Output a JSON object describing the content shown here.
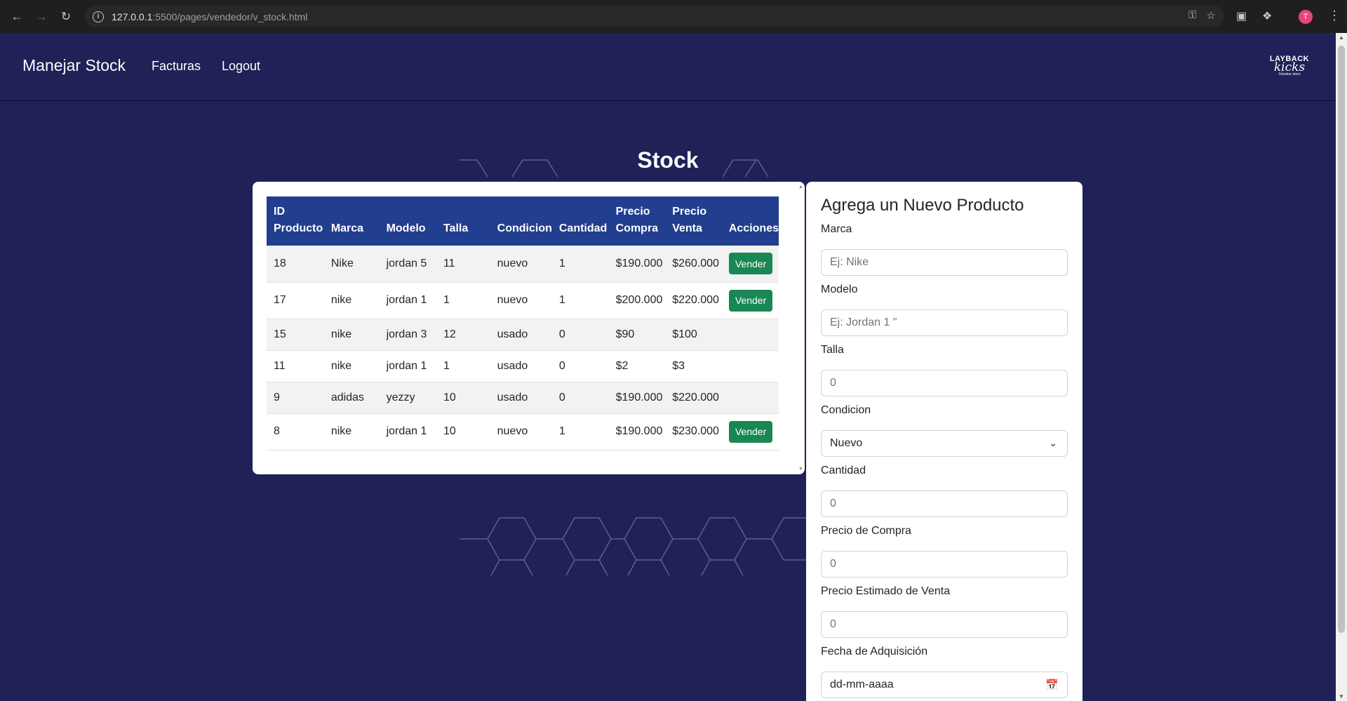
{
  "browser": {
    "url_host": "127.0.0.1",
    "url_path": ":5500/pages/vendedor/v_stock.html",
    "profile_initial": "T"
  },
  "navbar": {
    "brand": "Manejar Stock",
    "links": [
      "Facturas",
      "Logout"
    ],
    "logo": {
      "line1": "LAYBACK",
      "line2": "kicks",
      "line3": "Sneaker store"
    }
  },
  "main": {
    "title": "Stock",
    "table": {
      "headers": [
        "ID Producto",
        "Marca",
        "Modelo",
        "Talla",
        "Condicion",
        "Cantidad",
        "Precio Compra",
        "Precio Venta",
        "Acciones"
      ],
      "action_label": "Vender",
      "rows": [
        {
          "id": "18",
          "marca": "Nike",
          "modelo": "jordan 5",
          "talla": "11",
          "condicion": "nuevo",
          "cantidad": "1",
          "compra": "$190.000",
          "venta": "$260.000",
          "action": true
        },
        {
          "id": "17",
          "marca": "nike",
          "modelo": "jordan 1",
          "talla": "1",
          "condicion": "nuevo",
          "cantidad": "1",
          "compra": "$200.000",
          "venta": "$220.000",
          "action": true
        },
        {
          "id": "15",
          "marca": "nike",
          "modelo": "jordan 3",
          "talla": "12",
          "condicion": "usado",
          "cantidad": "0",
          "compra": "$90",
          "venta": "$100",
          "action": false
        },
        {
          "id": "11",
          "marca": "nike",
          "modelo": "jordan 1",
          "talla": "1",
          "condicion": "usado",
          "cantidad": "0",
          "compra": "$2",
          "venta": "$3",
          "action": false
        },
        {
          "id": "9",
          "marca": "adidas",
          "modelo": "yezzy",
          "talla": "10",
          "condicion": "usado",
          "cantidad": "0",
          "compra": "$190.000",
          "venta": "$220.000",
          "action": false
        },
        {
          "id": "8",
          "marca": "nike",
          "modelo": "jordan 1",
          "talla": "10",
          "condicion": "nuevo",
          "cantidad": "1",
          "compra": "$190.000",
          "venta": "$230.000",
          "action": true
        }
      ]
    }
  },
  "form": {
    "title": "Agrega un Nuevo Producto",
    "fields": [
      {
        "label": "Marca",
        "placeholder": "Ej: Nike",
        "value": ""
      },
      {
        "label": "Modelo",
        "placeholder": "Ej: Jordan 1 \"",
        "value": ""
      },
      {
        "label": "Talla",
        "placeholder": "0",
        "value": ""
      },
      {
        "label": "Condicion",
        "placeholder": "",
        "value": "Nuevo"
      },
      {
        "label": "Cantidad",
        "placeholder": "0",
        "value": ""
      },
      {
        "label": "Precio de Compra",
        "placeholder": "0",
        "value": ""
      },
      {
        "label": "Precio Estimado de Venta",
        "placeholder": "0",
        "value": ""
      },
      {
        "label": "Fecha de Adquisición",
        "placeholder": "",
        "value": "dd-mm-aaaa"
      }
    ]
  },
  "colors": {
    "background": "#1f2157",
    "table_header": "#213e8f",
    "vender_button": "#198754"
  }
}
